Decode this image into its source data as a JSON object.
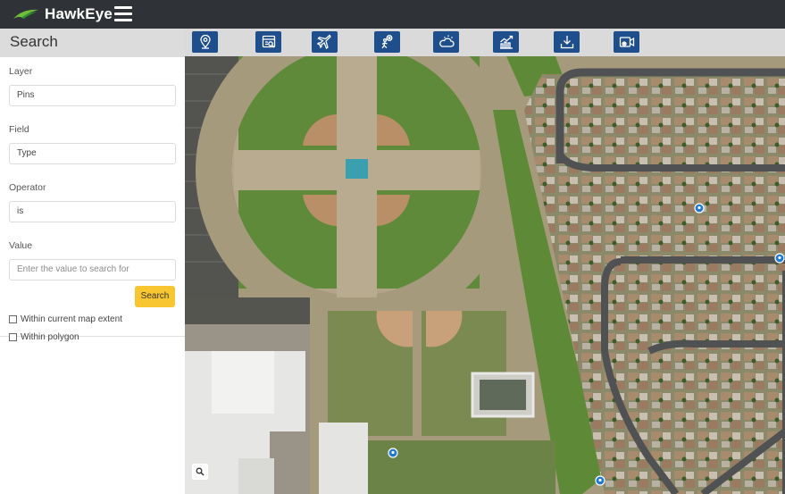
{
  "app": {
    "name": "HawkEye",
    "menu_icon": "hamburger-menu-icon",
    "logo_icon": "hawk-logo-icon"
  },
  "panel": {
    "title": "Search"
  },
  "search_form": {
    "layer": {
      "label": "Layer",
      "value": "Pins"
    },
    "field": {
      "label": "Field",
      "value": "Type"
    },
    "operator": {
      "label": "Operator",
      "value": "is"
    },
    "value": {
      "label": "Value",
      "placeholder": "Enter the value to search for"
    },
    "search_button": "Search",
    "options": [
      {
        "label": "Within current map extent",
        "checked": false
      },
      {
        "label": "Within polygon",
        "checked": false
      }
    ]
  },
  "toolbar": {
    "tools": [
      {
        "icon": "location-pin-icon"
      },
      {
        "icon": "map-search-icon"
      },
      {
        "icon": "airplane-icon"
      },
      {
        "icon": "person-location-icon"
      },
      {
        "icon": "weather-cloud-icon"
      },
      {
        "icon": "analytics-chart-icon"
      },
      {
        "icon": "download-icon"
      },
      {
        "icon": "video-camera-icon"
      }
    ]
  },
  "map": {
    "zoom_icon": "magnifier-icon",
    "pin_icon": "map-pin-icon",
    "pin_color": "#1f78d1"
  },
  "colors": {
    "header_bg": "#2f3338",
    "toolbar_button": "#1f4e8c",
    "accent_button": "#f8c630",
    "logo_green": "#6fbf3a"
  }
}
